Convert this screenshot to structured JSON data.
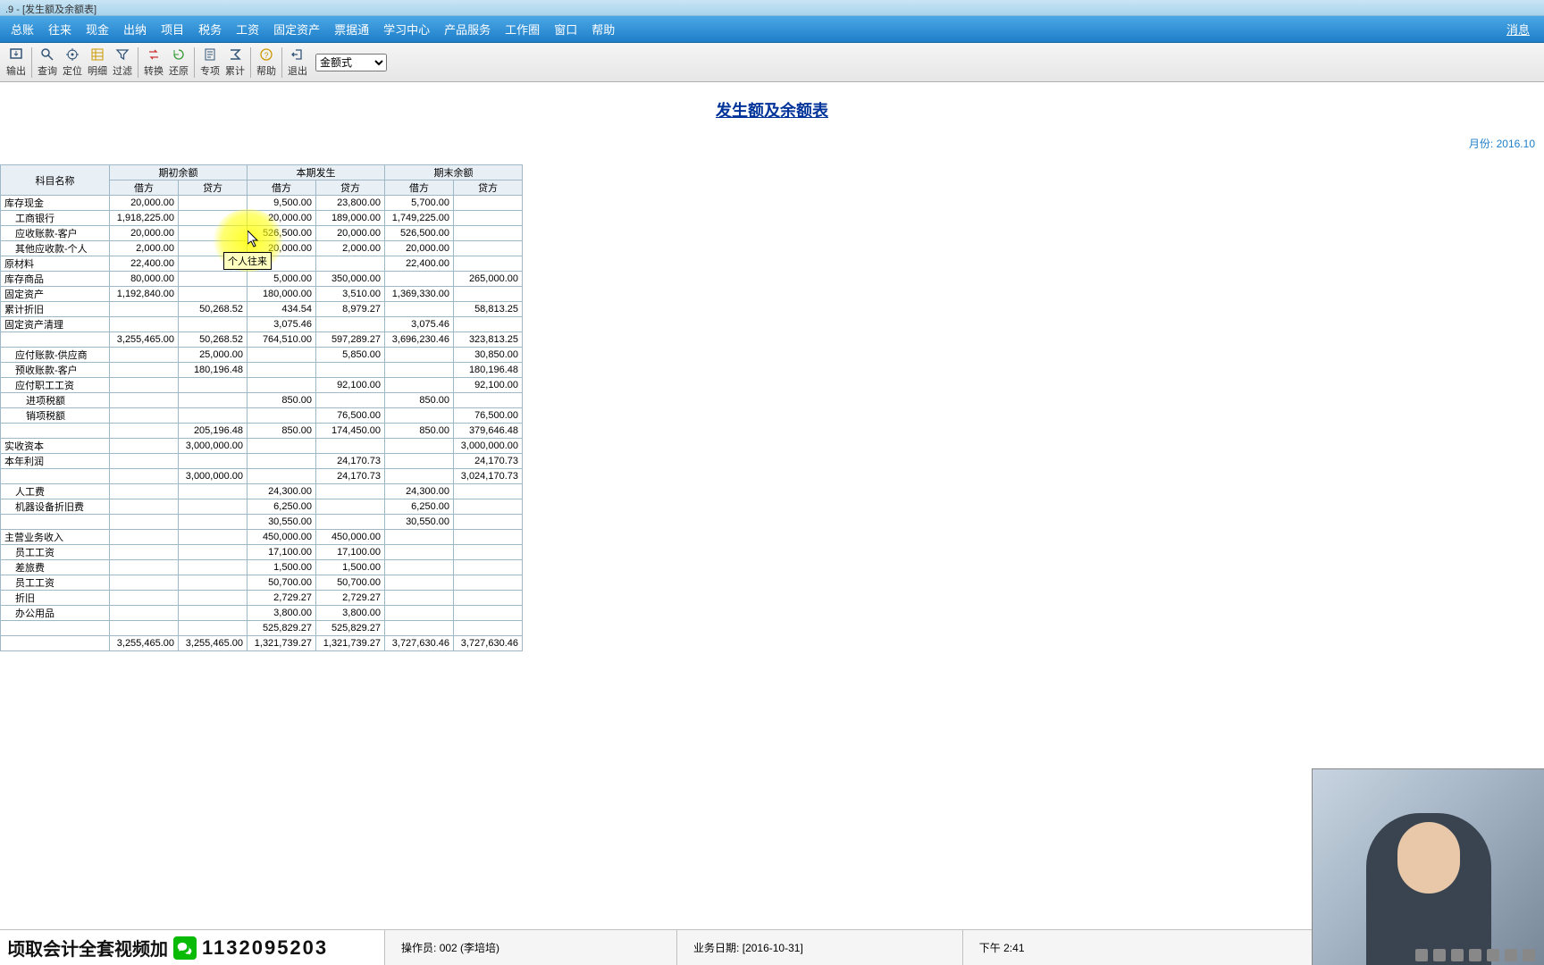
{
  "title": ".9 - [发生额及余额表]",
  "menus": [
    "总账",
    "往来",
    "现金",
    "出纳",
    "项目",
    "税务",
    "工资",
    "固定资产",
    "票据通",
    "学习中心",
    "产品服务",
    "工作圈",
    "窗口",
    "帮助"
  ],
  "msg_link": "消息",
  "toolbar": {
    "items": [
      "输出",
      "查询",
      "定位",
      "明细",
      "过滤",
      "转换",
      "还原",
      "专项",
      "累计",
      "帮助",
      "退出"
    ],
    "select_value": "金额式"
  },
  "report": {
    "title": "发生额及余额表",
    "month_label": "月份:",
    "month_value": "2016.10"
  },
  "table": {
    "h_name": "科目名称",
    "h_open": "期初余额",
    "h_period": "本期发生",
    "h_close": "期末余额",
    "h_debit": "借方",
    "h_credit": "贷方",
    "rows": [
      {
        "n": "库存现金",
        "i": 0,
        "c": [
          "20,000.00",
          "",
          "9,500.00",
          "23,800.00",
          "5,700.00",
          ""
        ]
      },
      {
        "n": "工商银行",
        "i": 1,
        "c": [
          "1,918,225.00",
          "",
          "20,000.00",
          "189,000.00",
          "1,749,225.00",
          ""
        ]
      },
      {
        "n": "应收账款-客户",
        "i": 1,
        "c": [
          "20,000.00",
          "",
          "526,500.00",
          "20,000.00",
          "526,500.00",
          ""
        ]
      },
      {
        "n": "其他应收款-个人",
        "i": 1,
        "c": [
          "2,000.00",
          "",
          "20,000.00",
          "2,000.00",
          "20,000.00",
          ""
        ]
      },
      {
        "n": "原材料",
        "i": 0,
        "c": [
          "22,400.00",
          "",
          "",
          "",
          "22,400.00",
          ""
        ]
      },
      {
        "n": "库存商品",
        "i": 0,
        "c": [
          "80,000.00",
          "",
          "5,000.00",
          "350,000.00",
          "",
          "265,000.00"
        ]
      },
      {
        "n": "固定资产",
        "i": 0,
        "c": [
          "1,192,840.00",
          "",
          "180,000.00",
          "3,510.00",
          "1,369,330.00",
          ""
        ]
      },
      {
        "n": "累计折旧",
        "i": 0,
        "c": [
          "",
          "50,268.52",
          "434.54",
          "8,979.27",
          "",
          "58,813.25"
        ]
      },
      {
        "n": "固定资产清理",
        "i": 0,
        "c": [
          "",
          "",
          "3,075.46",
          "",
          "3,075.46",
          ""
        ]
      },
      {
        "n": "",
        "i": 0,
        "c": [
          "3,255,465.00",
          "50,268.52",
          "764,510.00",
          "597,289.27",
          "3,696,230.46",
          "323,813.25"
        ]
      },
      {
        "n": "应付账款-供应商",
        "i": 1,
        "c": [
          "",
          "25,000.00",
          "",
          "5,850.00",
          "",
          "30,850.00"
        ]
      },
      {
        "n": "预收账款-客户",
        "i": 1,
        "c": [
          "",
          "180,196.48",
          "",
          "",
          "",
          "180,196.48"
        ]
      },
      {
        "n": "应付职工工资",
        "i": 1,
        "c": [
          "",
          "",
          "",
          "92,100.00",
          "",
          "92,100.00"
        ]
      },
      {
        "n": "进项税额",
        "i": 2,
        "c": [
          "",
          "",
          "850.00",
          "",
          "850.00",
          ""
        ]
      },
      {
        "n": "销项税额",
        "i": 2,
        "c": [
          "",
          "",
          "",
          "76,500.00",
          "",
          "76,500.00"
        ]
      },
      {
        "n": "",
        "i": 0,
        "c": [
          "",
          "205,196.48",
          "850.00",
          "174,450.00",
          "850.00",
          "379,646.48"
        ]
      },
      {
        "n": "实收资本",
        "i": 0,
        "c": [
          "",
          "3,000,000.00",
          "",
          "",
          "",
          "3,000,000.00"
        ]
      },
      {
        "n": "本年利润",
        "i": 0,
        "c": [
          "",
          "",
          "",
          "24,170.73",
          "",
          "24,170.73"
        ]
      },
      {
        "n": "",
        "i": 0,
        "c": [
          "",
          "3,000,000.00",
          "",
          "24,170.73",
          "",
          "3,024,170.73"
        ]
      },
      {
        "n": "人工费",
        "i": 1,
        "c": [
          "",
          "",
          "24,300.00",
          "",
          "24,300.00",
          ""
        ]
      },
      {
        "n": "机器设备折旧费",
        "i": 1,
        "c": [
          "",
          "",
          "6,250.00",
          "",
          "6,250.00",
          ""
        ]
      },
      {
        "n": "",
        "i": 0,
        "c": [
          "",
          "",
          "30,550.00",
          "",
          "30,550.00",
          ""
        ]
      },
      {
        "n": "主营业务收入",
        "i": 0,
        "c": [
          "",
          "",
          "450,000.00",
          "450,000.00",
          "",
          ""
        ]
      },
      {
        "n": "员工工资",
        "i": 1,
        "c": [
          "",
          "",
          "17,100.00",
          "17,100.00",
          "",
          ""
        ]
      },
      {
        "n": "差旅费",
        "i": 1,
        "c": [
          "",
          "",
          "1,500.00",
          "1,500.00",
          "",
          ""
        ]
      },
      {
        "n": "员工工资",
        "i": 1,
        "c": [
          "",
          "",
          "50,700.00",
          "50,700.00",
          "",
          ""
        ]
      },
      {
        "n": "折旧",
        "i": 1,
        "c": [
          "",
          "",
          "2,729.27",
          "2,729.27",
          "",
          ""
        ]
      },
      {
        "n": "办公用品",
        "i": 1,
        "c": [
          "",
          "",
          "3,800.00",
          "3,800.00",
          "",
          ""
        ]
      },
      {
        "n": "",
        "i": 0,
        "c": [
          "",
          "",
          "525,829.27",
          "525,829.27",
          "",
          ""
        ]
      },
      {
        "n": "",
        "i": 0,
        "c": [
          "3,255,465.00",
          "3,255,465.00",
          "1,321,739.27",
          "1,321,739.27",
          "3,727,630.46",
          "3,727,630.46"
        ]
      }
    ]
  },
  "tooltip": "个人往来",
  "status": {
    "operator_label": "操作员:",
    "operator_value": "002 (李培培)",
    "date_label": "业务日期:",
    "date_value": "[2016-10-31]",
    "time": "下午 2:41"
  },
  "banner": {
    "text": "顷取会计全套视频加",
    "qq": "1132095203"
  }
}
